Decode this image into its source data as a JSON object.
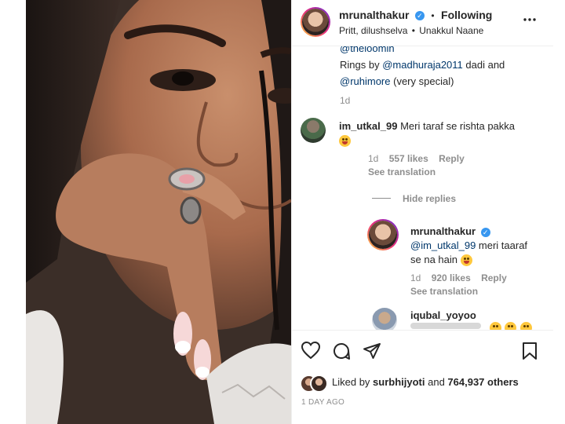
{
  "post": {
    "username": "mrunalthakur",
    "separator": "•",
    "following": "Following",
    "subtitle_people": "Pritt, dilushselva",
    "subtitle_sep": "•",
    "subtitle_place": "Unakkul Naane",
    "more_icon": "more-horizontal-icon"
  },
  "caption": {
    "clipped_mention": "@theloomin",
    "text_prefix": "Rings by ",
    "mention1": "@madhuraja2011",
    "text_mid": " dadi and",
    "mention2": "@ruhimore",
    "text_suffix": " (very special)",
    "time": "1d"
  },
  "comments": [
    {
      "username": "im_utkal_99",
      "text": "Meri taraf se rishta pakka",
      "time": "1d",
      "likes": "557 likes",
      "reply": "Reply",
      "translation": "See translation",
      "hide_replies": "Hide replies"
    }
  ],
  "reply": {
    "username": "mrunalthakur",
    "mention": "@im_utkal_99",
    "text": " meri taaraf se na hain",
    "time": "1d",
    "likes": "920 likes",
    "reply": "Reply",
    "translation": "See translation"
  },
  "next_reply": {
    "username": "iqubal_yoyoo"
  },
  "likes": {
    "prefix": "Liked by ",
    "user": "surbhijyoti",
    "and": " and ",
    "count": "764,937 others"
  },
  "date": "1 DAY AGO",
  "colors": {
    "verified": "#3897f0",
    "mention": "#00376b",
    "meta": "#8e8e8e"
  }
}
